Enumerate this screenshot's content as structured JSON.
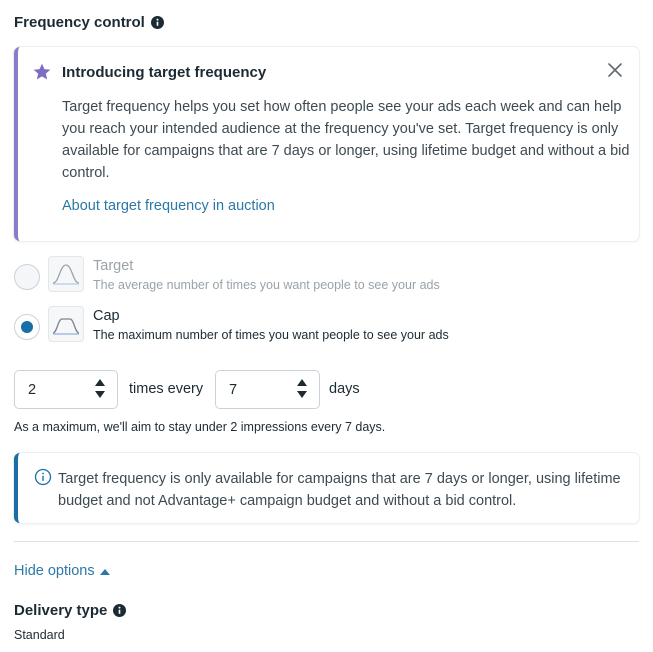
{
  "section": {
    "title": "Frequency control"
  },
  "promo": {
    "title": "Introducing target frequency",
    "body": "Target frequency helps you set how often people see your ads each week and can help you reach your intended audience at the frequency you've set. Target frequency is only available for campaigns that are 7 days or longer, using lifetime budget and without a bid control.",
    "link": "About target frequency in auction",
    "accent_color": "#8b7cc8"
  },
  "options": [
    {
      "label": "Target",
      "description": "The average number of times you want people to see your ads",
      "selected": false,
      "disabled": true
    },
    {
      "label": "Cap",
      "description": "The maximum number of times you want people to see your ads",
      "selected": true,
      "disabled": false
    }
  ],
  "frequency": {
    "impressions": "2",
    "times_every_label": "times every",
    "days_value": "7",
    "days_label": "days",
    "helper": "As a maximum, we'll aim to stay under 2 impressions every 7 days."
  },
  "note": {
    "text": "Target frequency is only available for campaigns that are 7 days or longer, using lifetime budget and not Advantage+ campaign budget and without a bid control.",
    "accent_color": "#1a6ea8"
  },
  "hide_options": {
    "label": "Hide options"
  },
  "delivery": {
    "title": "Delivery type",
    "value": "Standard"
  }
}
